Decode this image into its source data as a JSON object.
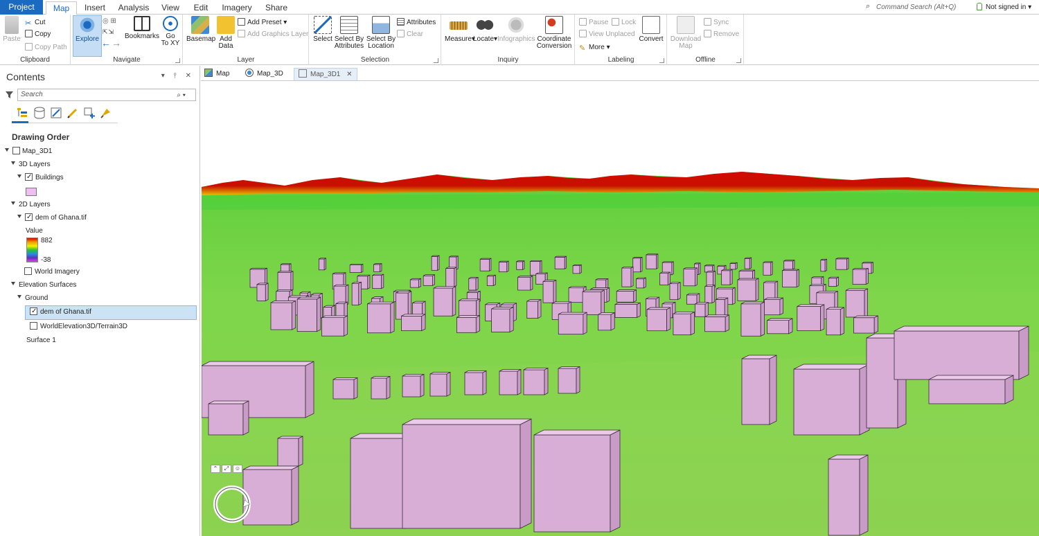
{
  "ribbon_tabs": [
    "Project",
    "Map",
    "Insert",
    "Analysis",
    "View",
    "Edit",
    "Imagery",
    "Share"
  ],
  "command_search": "Command Search (Alt+Q)",
  "signin": "Not signed in ▾",
  "clipboard": {
    "title": "Clipboard",
    "paste": "Paste",
    "cut": "Cut",
    "copy": "Copy",
    "copy_path": "Copy Path"
  },
  "navigate": {
    "title": "Navigate",
    "explore": "Explore",
    "bookmarks": "Bookmarks",
    "go_to_xy": "Go\nTo XY"
  },
  "layer": {
    "title": "Layer",
    "basemap": "Basemap",
    "add_data": "Add\nData",
    "add_preset": "Add Preset",
    "add_graphics_layer": "Add Graphics Layer"
  },
  "selection": {
    "title": "Selection",
    "select": "Select",
    "select_by_attributes": "Select By\nAttributes",
    "select_by_location": "Select By\nLocation",
    "attributes": "Attributes",
    "clear": "Clear"
  },
  "inquiry": {
    "title": "Inquiry",
    "measure": "Measure",
    "locate": "Locate",
    "infographics": "Infographics",
    "coordinate_conversion": "Coordinate\nConversion"
  },
  "labeling": {
    "title": "Labeling",
    "pause": "Pause",
    "lock": "Lock",
    "view_unplaced": "View Unplaced",
    "more": "More",
    "convert": "Convert"
  },
  "offline": {
    "title": "Offline",
    "download_map": "Download\nMap",
    "sync": "Sync",
    "remove": "Remove"
  },
  "contents": {
    "title": "Contents",
    "controls": "▾ ⫯ ✕",
    "search_placeholder": "Search",
    "drawing_order": "Drawing Order",
    "map_name": "Map_3D1",
    "layers_3d": "3D Layers",
    "buildings": "Buildings",
    "layers_2d": "2D Layers",
    "dem_layer": "dem of Ghana.tif",
    "value_label": "Value",
    "value_max": "882",
    "value_min": "-38",
    "world_imagery": "World Imagery",
    "elevation_surfaces": "Elevation Surfaces",
    "ground": "Ground",
    "ground_dem": "dem of Ghana.tif",
    "world_elevation": "WorldElevation3D/Terrain3D",
    "surface1": "Surface 1"
  },
  "map_tabs": [
    "Map",
    "Map_3D",
    "Map_3D1"
  ],
  "map_tab_close": "✕",
  "colors": {
    "accent": "#1b6ac1",
    "terrain_green": "#7bd84a",
    "terrain_red": "#d10b00",
    "building_fill": "#d8aed6",
    "sky": "#ffffff"
  }
}
